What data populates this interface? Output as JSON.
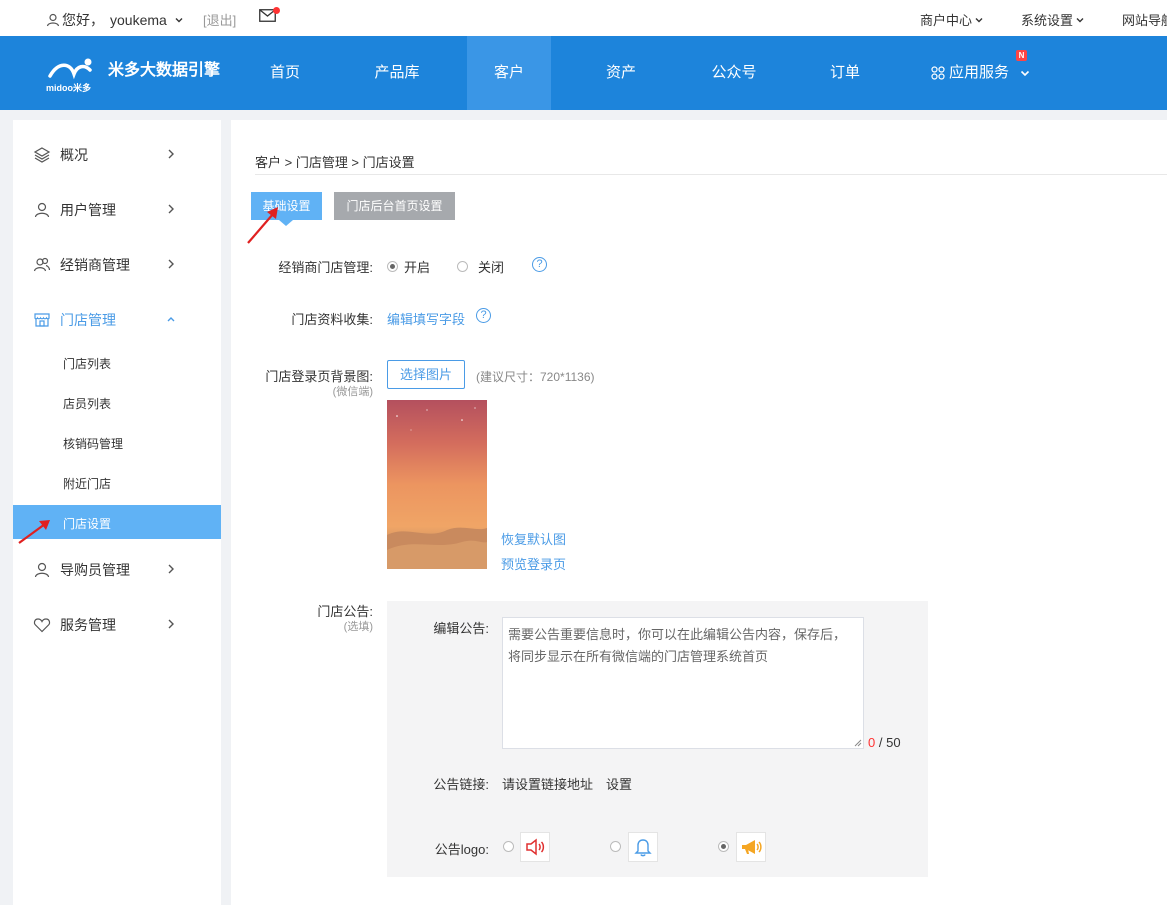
{
  "topbar": {
    "greeting": "您好，",
    "username": "youkema",
    "logout": "[退出]",
    "links": [
      "商户中心",
      "系统设置",
      "网站导航"
    ]
  },
  "nav": {
    "brand": "米多大数据引擎",
    "logo_text": "midoo米多",
    "items": [
      "首页",
      "产品库",
      "客户",
      "资产",
      "公众号",
      "订单",
      "应用服务"
    ],
    "active": "客户",
    "badge": "N"
  },
  "sidebar": {
    "items": [
      {
        "label": "概况",
        "icon": "layers-icon"
      },
      {
        "label": "用户管理",
        "icon": "user-icon"
      },
      {
        "label": "经销商管理",
        "icon": "users-icon"
      },
      {
        "label": "门店管理",
        "icon": "store-icon"
      },
      {
        "label": "导购员管理",
        "icon": "user-icon"
      },
      {
        "label": "服务管理",
        "icon": "heart-icon"
      }
    ],
    "sub_items": [
      "门店列表",
      "店员列表",
      "核销码管理",
      "附近门店",
      "门店设置"
    ],
    "selected_sub": "门店设置"
  },
  "main": {
    "breadcrumb": "客户 > 门店管理 > 门店设置",
    "tabs": [
      "基础设置",
      "门店后台首页设置"
    ],
    "dealer_store": {
      "label": "经销商门店管理:",
      "options": [
        "开启",
        "关闭"
      ],
      "selected": "开启"
    },
    "collect": {
      "label": "门店资料收集:",
      "link": "编辑填写字段"
    },
    "login_bg": {
      "label": "门店登录页背景图:",
      "sublabel": "(微信端)",
      "button": "选择图片",
      "hint": "(建议尺寸：720*1136)",
      "restore": "恢复默认图",
      "preview": "预览登录页"
    },
    "notice": {
      "label": "门店公告:",
      "sublabel": "(选填)",
      "edit_label": "编辑公告:",
      "placeholder": "需要公告重要信息时，你可以在此编辑公告内容，保存后，将同步显示在所有微信端的门店管理系统首页",
      "count": "0",
      "max": "/ 50",
      "link_label": "公告链接:",
      "link_value": "请设置链接地址",
      "link_set": "设置",
      "logo_label": "公告logo:",
      "logo_options": [
        "speaker-icon",
        "bell-icon",
        "megaphone-icon"
      ],
      "logo_selected": 2
    }
  },
  "colors": {
    "nav": "#1d84db",
    "accent": "#60b2f5",
    "link": "#4a9be6"
  }
}
